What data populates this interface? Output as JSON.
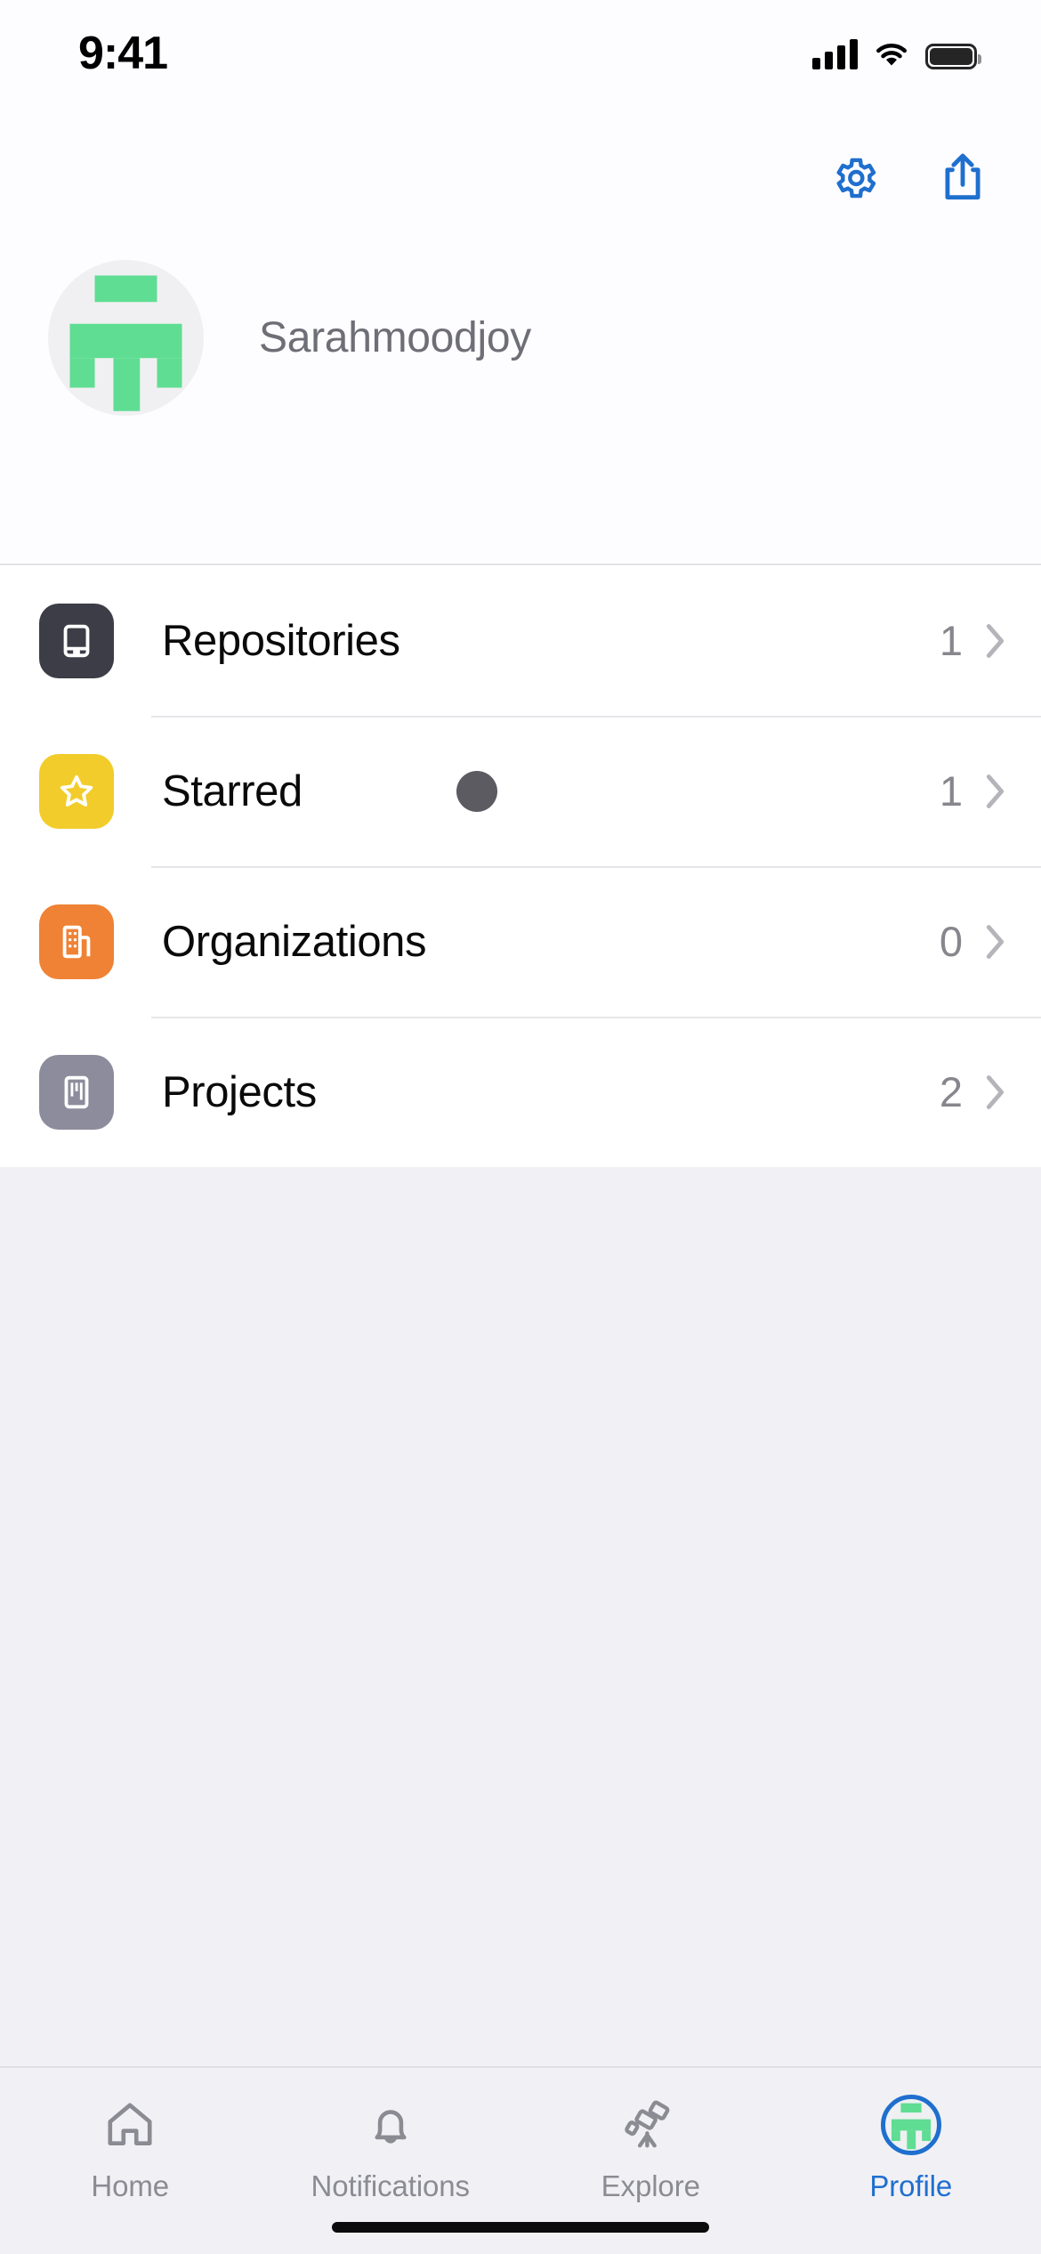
{
  "status_bar": {
    "time": "9:41",
    "signal_icon": "cellular-signal-icon",
    "wifi_icon": "wifi-icon",
    "battery_icon": "battery-full-icon"
  },
  "header": {
    "settings_icon": "gear-icon",
    "share_icon": "share-icon",
    "accent_color": "#1f6fce",
    "avatar_icon": "user-identicon-avatar",
    "avatar_color": "#5fdd92",
    "avatar_bg": "#f0f0f2",
    "username": "Sarahmoodjoy"
  },
  "list": {
    "rows": [
      {
        "label": "Repositories",
        "count": "1",
        "icon": "repo-book-icon",
        "tile_color": "#3d3d47",
        "chevron": "chevron-right-icon",
        "has_cursor": false
      },
      {
        "label": "Starred",
        "count": "1",
        "icon": "star-icon",
        "tile_color": "#f2cc2b",
        "chevron": "chevron-right-icon",
        "has_cursor": true
      },
      {
        "label": "Organizations",
        "count": "0",
        "icon": "organization-building-icon",
        "tile_color": "#ef8234",
        "chevron": "chevron-right-icon",
        "has_cursor": false
      },
      {
        "label": "Projects",
        "count": "2",
        "icon": "project-board-icon",
        "tile_color": "#8c8c9c",
        "chevron": "chevron-right-icon",
        "has_cursor": false
      }
    ]
  },
  "tab_bar": {
    "active_color": "#1f6fce",
    "inactive_color": "#8b8b93",
    "tabs": [
      {
        "label": "Home",
        "icon": "home-icon",
        "active": false
      },
      {
        "label": "Notifications",
        "icon": "bell-icon",
        "active": false
      },
      {
        "label": "Explore",
        "icon": "telescope-icon",
        "active": false
      },
      {
        "label": "Profile",
        "icon": "profile-avatar-icon",
        "active": true
      }
    ]
  }
}
